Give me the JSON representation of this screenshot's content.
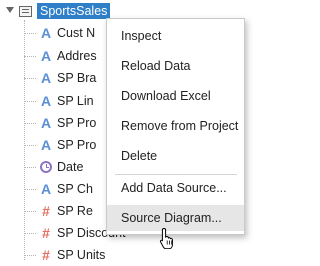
{
  "tree": {
    "root_label": "SportsSales",
    "items": [
      {
        "label": "Cust N",
        "icon": "text-field-icon"
      },
      {
        "label": "Addres",
        "icon": "text-field-icon"
      },
      {
        "label": "SP Bra",
        "icon": "text-field-icon"
      },
      {
        "label": "SP Lin",
        "icon": "text-field-icon"
      },
      {
        "label": "SP Pro",
        "icon": "text-field-icon"
      },
      {
        "label": "SP Pro",
        "icon": "text-field-icon"
      },
      {
        "label": "Date",
        "icon": "date-field-icon"
      },
      {
        "label": "SP Ch",
        "icon": "text-field-icon"
      },
      {
        "label": "SP Re",
        "icon": "numeric-field-icon"
      },
      {
        "label": "SP Discount",
        "icon": "numeric-field-icon"
      },
      {
        "label": "SP Units",
        "icon": "numeric-field-icon"
      }
    ]
  },
  "context_menu": {
    "items": [
      "Inspect",
      "Reload Data",
      "Download Excel",
      "Remove from Project",
      "Delete",
      "Add Data Source...",
      "Source Diagram..."
    ],
    "highlighted": "Source Diagram..."
  },
  "colors": {
    "selection": "#2f7fc8",
    "text_icon": "#5b8fd6",
    "numeric_icon": "#e4705e",
    "date_icon": "#8f74c4"
  }
}
